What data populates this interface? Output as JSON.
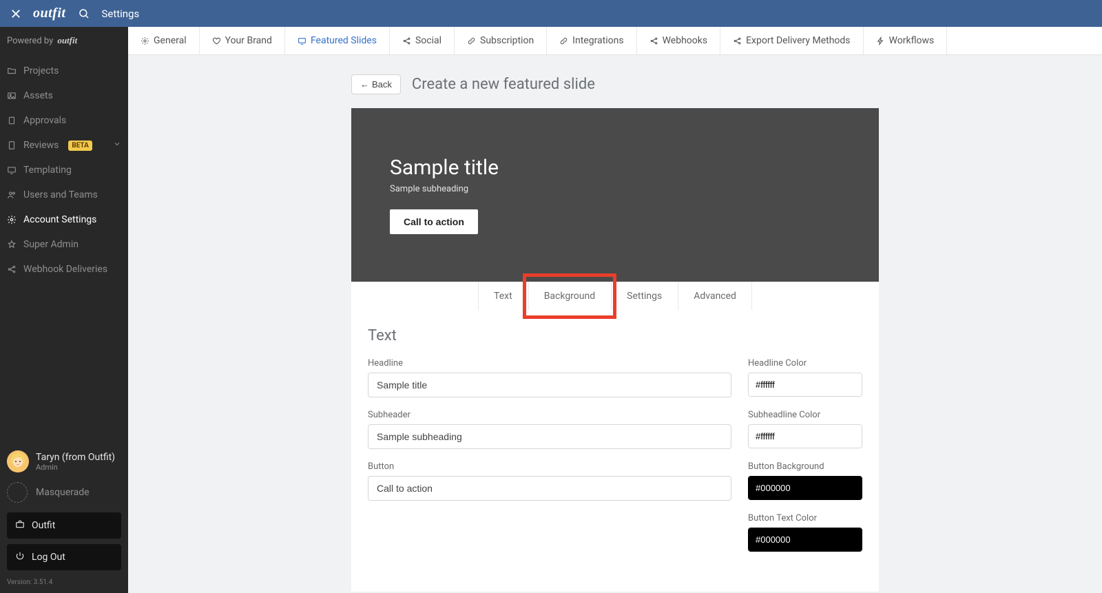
{
  "topbar": {
    "title": "Settings",
    "brand": "outfit"
  },
  "sidebar": {
    "powered_label": "Powered by",
    "powered_brand": "outfit",
    "items": [
      {
        "label": "Projects"
      },
      {
        "label": "Assets"
      },
      {
        "label": "Approvals"
      },
      {
        "label": "Reviews",
        "beta": "BETA",
        "chevron": true
      },
      {
        "label": "Templating"
      },
      {
        "label": "Users and Teams"
      },
      {
        "label": "Account Settings",
        "active": true
      },
      {
        "label": "Super Admin"
      },
      {
        "label": "Webhook Deliveries"
      }
    ],
    "user": {
      "name": "Taryn (from Outfit)",
      "role": "Admin"
    },
    "masquerade_label": "Masquerade",
    "outfit_btn": "Outfit",
    "logout_btn": "Log Out",
    "version": "Version: 3.51.4"
  },
  "tabs": [
    {
      "label": "General"
    },
    {
      "label": "Your Brand"
    },
    {
      "label": "Featured Slides",
      "active": true
    },
    {
      "label": "Social"
    },
    {
      "label": "Subscription"
    },
    {
      "label": "Integrations"
    },
    {
      "label": "Webhooks"
    },
    {
      "label": "Export Delivery Methods"
    },
    {
      "label": "Workflows"
    }
  ],
  "header": {
    "back": "Back",
    "title": "Create a new featured slide"
  },
  "preview": {
    "title": "Sample title",
    "subheading": "Sample subheading",
    "cta": "Call to action"
  },
  "edit_tabs": [
    {
      "label": "Text"
    },
    {
      "label": "Background",
      "highlighted": true
    },
    {
      "label": "Settings"
    },
    {
      "label": "Advanced"
    }
  ],
  "panel": {
    "title": "Text",
    "labels": {
      "headline": "Headline",
      "subheader": "Subheader",
      "button": "Button",
      "headline_color": "Headline Color",
      "subheadline_color": "Subheadline Color",
      "button_bg": "Button Background",
      "button_text_color": "Button Text Color"
    },
    "values": {
      "headline": "Sample title",
      "subheader": "Sample subheading",
      "button": "Call to action",
      "headline_color": "#ffffff",
      "subheadline_color": "#ffffff",
      "button_bg": "#000000",
      "button_text_color": "#000000"
    }
  },
  "colors": {
    "accent": "#3471c8",
    "highlight": "#ea3e2b"
  }
}
